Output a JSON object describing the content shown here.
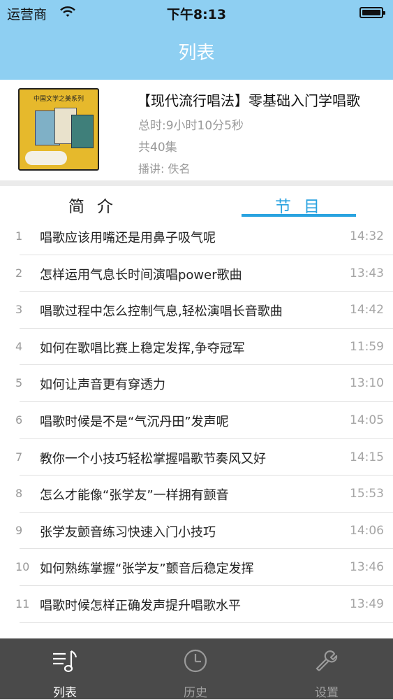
{
  "status_bar": {
    "carrier": "运营商",
    "time": "下午8:13"
  },
  "nav": {
    "title": "列表"
  },
  "book": {
    "cover_series": "中国文学之美系列",
    "title": "【现代流行唱法】零基础入门学唱歌",
    "total_time": "总时:9小时10分5秒",
    "episodes": "共40集",
    "narrator": "播讲: 佚名"
  },
  "tabs": {
    "intro": "简介",
    "programs": "节目"
  },
  "episodes": [
    {
      "num": "1",
      "title": "唱歌应该用嘴还是用鼻子吸气呢",
      "duration": "14:32"
    },
    {
      "num": "2",
      "title": "怎样运用气息长时间演唱power歌曲",
      "duration": "13:43"
    },
    {
      "num": "3",
      "title": "唱歌过程中怎么控制气息,轻松演唱长音歌曲",
      "duration": "14:42"
    },
    {
      "num": "4",
      "title": "如何在歌唱比赛上稳定发挥,争夺冠军",
      "duration": "11:59"
    },
    {
      "num": "5",
      "title": "如何让声音更有穿透力",
      "duration": "13:10"
    },
    {
      "num": "6",
      "title": "唱歌时候是不是“气沉丹田”发声呢",
      "duration": "14:05"
    },
    {
      "num": "7",
      "title": "教你一个小技巧轻松掌握唱歌节奏风又好",
      "duration": "14:15"
    },
    {
      "num": "8",
      "title": "怎么才能像“张学友”一样拥有颤音",
      "duration": "15:53"
    },
    {
      "num": "9",
      "title": "张学友颤音练习快速入门小技巧",
      "duration": "14:06"
    },
    {
      "num": "10",
      "title": "如何熟练掌握“张学友”颤音后稳定发挥",
      "duration": "13:46"
    },
    {
      "num": "11",
      "title": "唱歌时候怎样正确发声提升唱歌水平",
      "duration": "13:49"
    }
  ],
  "tab_bar": {
    "items": [
      {
        "label": "列表",
        "icon": "music-list-icon",
        "active": true
      },
      {
        "label": "历史",
        "icon": "clock-icon",
        "active": false
      },
      {
        "label": "设置",
        "icon": "wrench-icon",
        "active": false
      }
    ]
  }
}
